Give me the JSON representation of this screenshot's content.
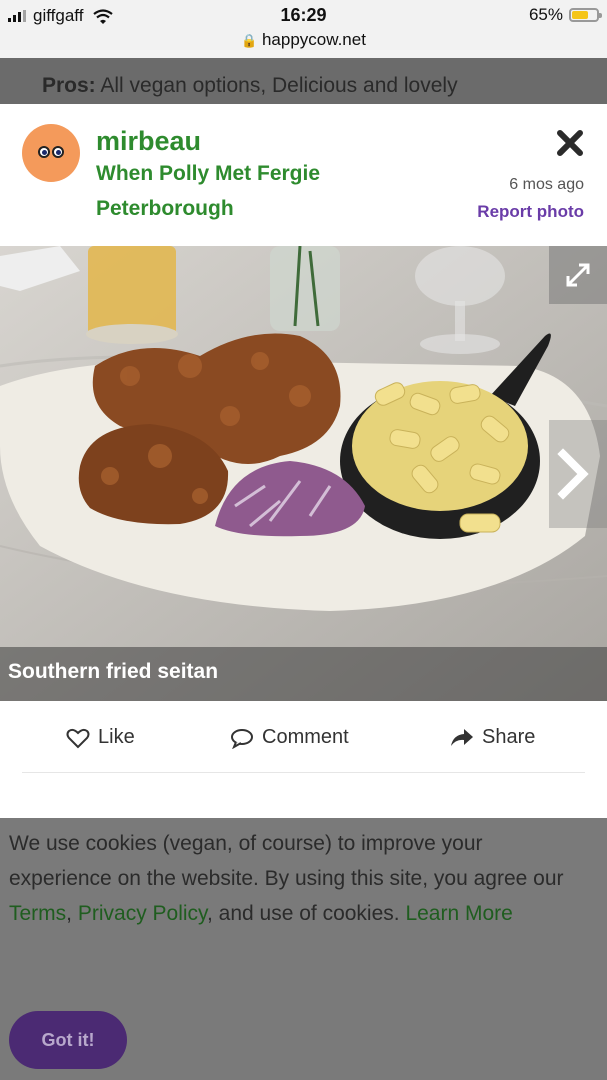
{
  "status_bar": {
    "carrier": "giffgaff",
    "time": "16:29",
    "url": "happycow.net",
    "battery": "65%",
    "battery_level": 0.65,
    "battery_color": "#f5c518"
  },
  "background_review": {
    "label": "Pros:",
    "text": "All vegan options, Delicious and lovely"
  },
  "photo_modal": {
    "username": "mirbeau",
    "venue": "When Polly Met Fergie",
    "city": "Peterborough",
    "time_ago": "6 mos ago",
    "report_label": "Report photo",
    "caption": "Southern fried seitan",
    "close_icon": "close-icon",
    "expand_icon": "expand-icon",
    "next_icon": "chevron-right-icon"
  },
  "actions": {
    "like": "Like",
    "comment": "Comment",
    "share": "Share"
  },
  "cookie_banner": {
    "text_1": "We use cookies (vegan, of course) to improve your experience on the website. By using this site, you agree our ",
    "terms": "Terms",
    "sep": ", ",
    "privacy": "Privacy Policy",
    "text_2": ", and use of cookies. ",
    "learn_more": "Learn More",
    "button": "Got it!"
  },
  "colors": {
    "brand_green": "#2e8b2e",
    "report_purple": "#6a3ca8",
    "button_purple": "#4b2a73"
  }
}
